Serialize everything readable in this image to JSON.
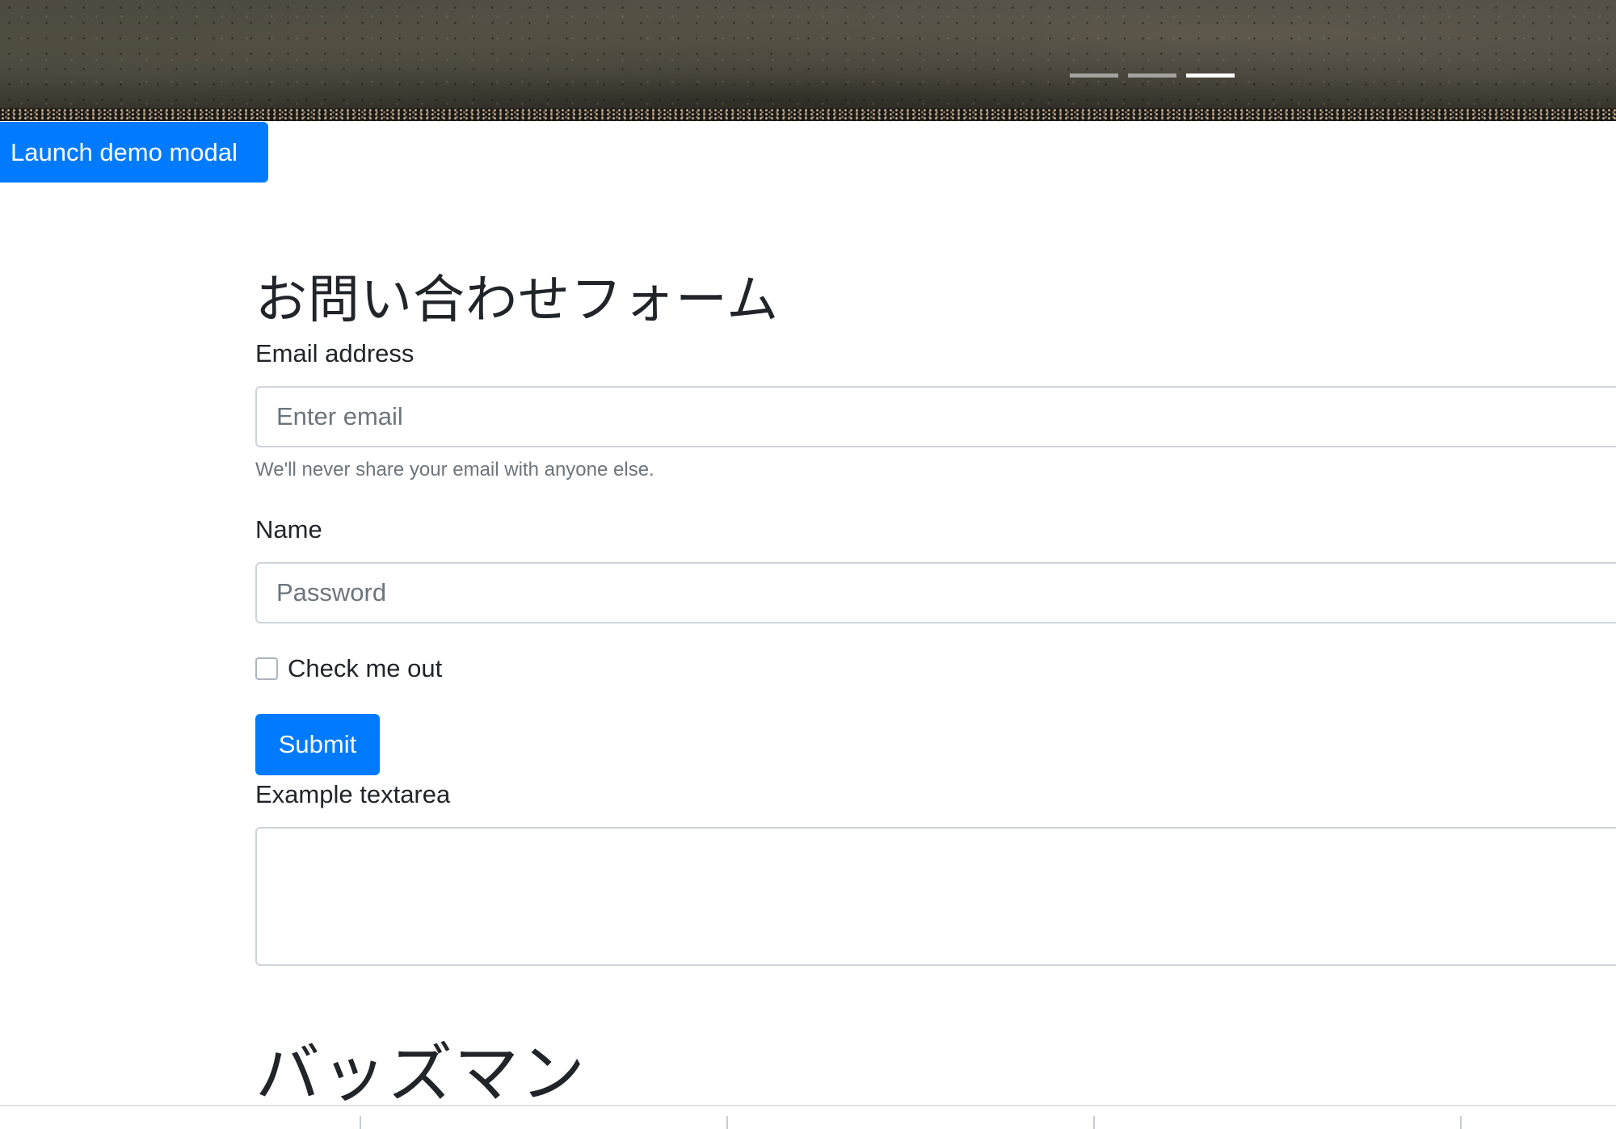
{
  "carousel": {
    "indicator_count": 3,
    "active_index": 2
  },
  "modal": {
    "launch_label": "Launch demo modal"
  },
  "form": {
    "title": "お問い合わせフォーム",
    "email_label": "Email address",
    "email_placeholder": "Enter email",
    "email_help": "We'll never share your email with anyone else.",
    "name_label": "Name",
    "name_placeholder": "Password",
    "checkbox_label": "Check me out",
    "checkbox_checked": false,
    "submit_label": "Submit",
    "textarea_label": "Example textarea",
    "textarea_value": ""
  },
  "section": {
    "title": "バッズマン"
  },
  "colors": {
    "primary": "#007bff",
    "text": "#212529",
    "muted": "#6c757d",
    "border": "#ced4da"
  }
}
